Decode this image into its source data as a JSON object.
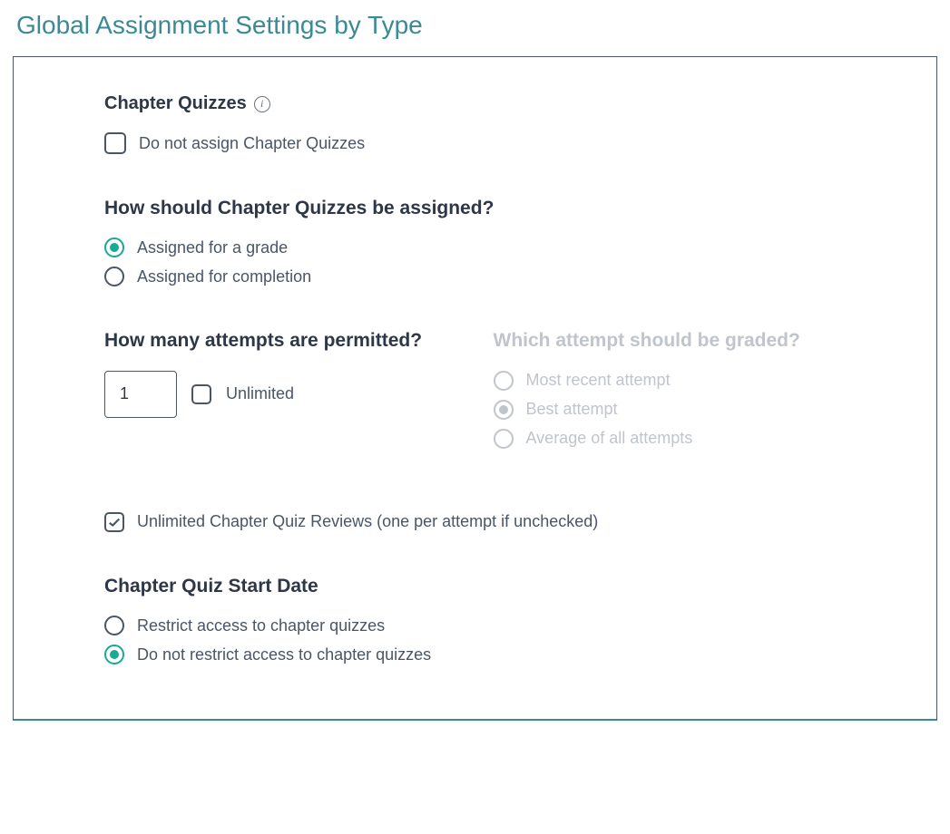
{
  "page": {
    "title": "Global Assignment Settings by Type"
  },
  "chapterQuizzes": {
    "heading": "Chapter Quizzes",
    "doNotAssign": {
      "label": "Do not assign Chapter Quizzes",
      "checked": false
    }
  },
  "assignMethod": {
    "heading": "How should Chapter Quizzes be assigned?",
    "options": {
      "grade": "Assigned for a grade",
      "completion": "Assigned for completion"
    },
    "selected": "grade"
  },
  "attempts": {
    "heading": "How many attempts are permitted?",
    "value": "1",
    "unlimited": {
      "label": "Unlimited",
      "checked": false
    }
  },
  "graded": {
    "heading": "Which attempt should be graded?",
    "options": {
      "recent": "Most recent attempt",
      "best": "Best attempt",
      "average": "Average of all attempts"
    },
    "selected": "best",
    "disabled": true
  },
  "reviews": {
    "label": "Unlimited Chapter Quiz Reviews (one per attempt if unchecked)",
    "checked": true
  },
  "startDate": {
    "heading": "Chapter Quiz Start Date",
    "options": {
      "restrict": "Restrict access to chapter quizzes",
      "noRestrict": "Do not restrict access to chapter quizzes"
    },
    "selected": "noRestrict"
  }
}
